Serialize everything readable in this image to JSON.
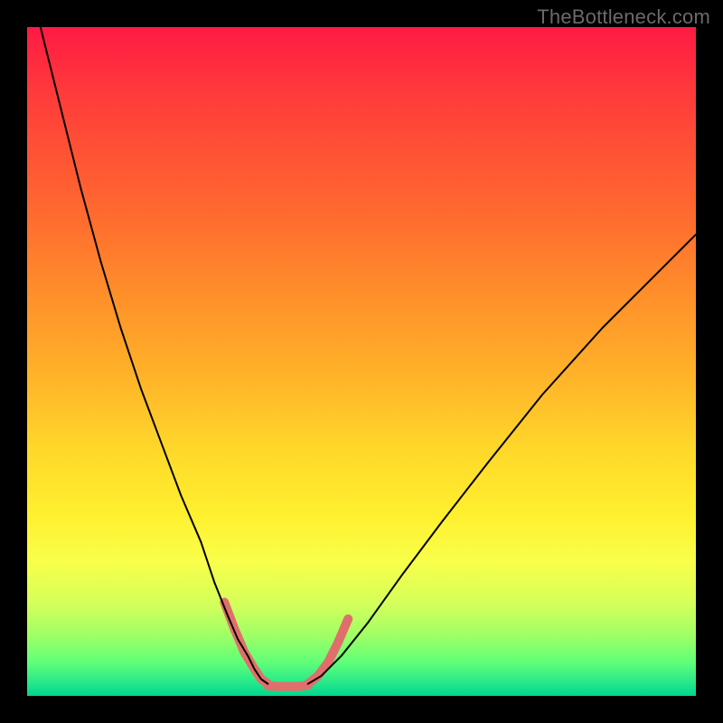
{
  "watermark": "TheBottleneck.com",
  "chart_data": {
    "type": "line",
    "title": "",
    "xlabel": "",
    "ylabel": "",
    "xlim": [
      0,
      100
    ],
    "ylim": [
      0,
      100
    ],
    "grid": false,
    "legend": false,
    "series": [
      {
        "name": "black-curve-left",
        "color": "#000000",
        "stroke_width": 2,
        "x": [
          2,
          5,
          8,
          11,
          14,
          17,
          20,
          23,
          26,
          28,
          30,
          31.5,
          33,
          34,
          35,
          36
        ],
        "y": [
          100,
          88,
          76,
          65,
          55,
          46,
          38,
          30,
          23,
          17,
          12,
          8.5,
          6,
          4,
          2.5,
          1.8
        ]
      },
      {
        "name": "black-curve-right",
        "color": "#000000",
        "stroke_width": 2,
        "x": [
          42,
          44,
          47,
          51,
          56,
          62,
          69,
          77,
          86,
          95,
          100
        ],
        "y": [
          1.8,
          3,
          6,
          11,
          18,
          26,
          35,
          45,
          55,
          64,
          69
        ]
      },
      {
        "name": "pink-curve-left",
        "color": "#e06f6c",
        "stroke_width": 10,
        "x": [
          29.5,
          31,
          32.5,
          34,
          35,
          36
        ],
        "y": [
          14,
          10,
          6.5,
          4,
          2.5,
          1.8
        ]
      },
      {
        "name": "pink-floor",
        "color": "#e06f6c",
        "stroke_width": 10,
        "x": [
          36,
          37.5,
          39,
          40.5,
          42
        ],
        "y": [
          1.5,
          1.4,
          1.4,
          1.4,
          1.6
        ]
      },
      {
        "name": "pink-curve-right",
        "color": "#e06f6c",
        "stroke_width": 10,
        "x": [
          42,
          43.5,
          45,
          46.5,
          48
        ],
        "y": [
          1.8,
          3,
          5,
          8,
          11.5
        ]
      }
    ],
    "gradient_background": {
      "orientation": "vertical",
      "stops": [
        {
          "pos": 0,
          "color": "#ff1a44"
        },
        {
          "pos": 10,
          "color": "#ff3b3b"
        },
        {
          "pos": 28,
          "color": "#ff6a2f"
        },
        {
          "pos": 40,
          "color": "#ff8f2a"
        },
        {
          "pos": 52,
          "color": "#ffb229"
        },
        {
          "pos": 63,
          "color": "#ffd72a"
        },
        {
          "pos": 73,
          "color": "#fff02f"
        },
        {
          "pos": 80,
          "color": "#f8ff4a"
        },
        {
          "pos": 86,
          "color": "#d6ff5a"
        },
        {
          "pos": 91,
          "color": "#9fff66"
        },
        {
          "pos": 95,
          "color": "#5fff78"
        },
        {
          "pos": 98,
          "color": "#27e88a"
        },
        {
          "pos": 100,
          "color": "#00d58f"
        }
      ]
    }
  }
}
